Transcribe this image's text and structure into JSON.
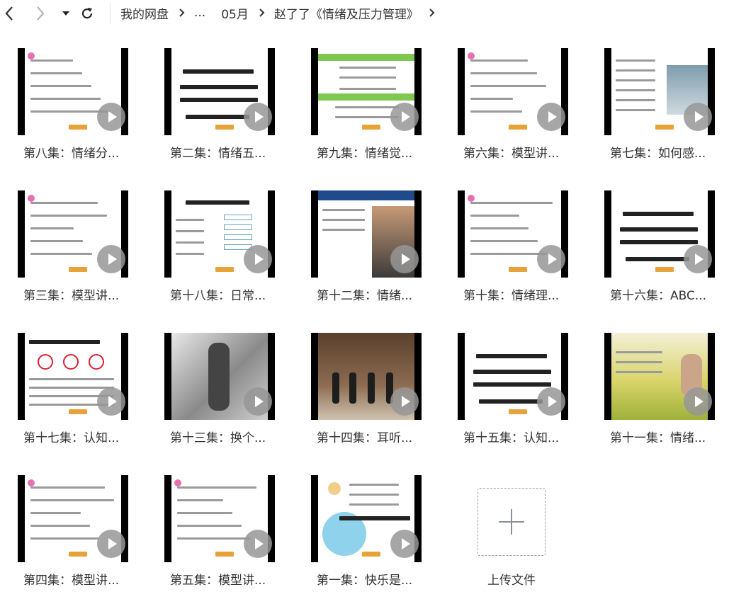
{
  "toolbar": {
    "back_icon": "chevron-left-icon",
    "forward_icon": "chevron-right-icon",
    "dropdown_icon": "caret-down-icon",
    "refresh_icon": "refresh-icon"
  },
  "breadcrumb": [
    "我的网盘",
    "...",
    "05月",
    "赵了了《情绪及压力管理》"
  ],
  "files": [
    {
      "name": "第八集：情绪分...",
      "thumb": "text"
    },
    {
      "name": "第二集：情绪五...",
      "thumb": "title"
    },
    {
      "name": "第九集：情绪觉...",
      "thumb": "bands"
    },
    {
      "name": "第六集：模型讲...",
      "thumb": "text"
    },
    {
      "name": "第七集：如何感...",
      "thumb": "photo-side"
    },
    {
      "name": "第三集：模型讲...",
      "thumb": "text"
    },
    {
      "name": "第十八集：日常...",
      "thumb": "diagram"
    },
    {
      "name": "第十二集：情绪...",
      "thumb": "person"
    },
    {
      "name": "第十集：情绪理...",
      "thumb": "text"
    },
    {
      "name": "第十六集：ABC...",
      "thumb": "title"
    },
    {
      "name": "第十七集：认知...",
      "thumb": "circles"
    },
    {
      "name": "第十三集：换个...",
      "thumb": "sketch"
    },
    {
      "name": "第十四集：耳听...",
      "thumb": "scene"
    },
    {
      "name": "第十五集：认知...",
      "thumb": "title"
    },
    {
      "name": "第十一集：情绪...",
      "thumb": "field"
    },
    {
      "name": "第四集：模型讲...",
      "thumb": "text"
    },
    {
      "name": "第五集：模型讲...",
      "thumb": "text"
    },
    {
      "name": "第一集：快乐是...",
      "thumb": "bubbles"
    }
  ],
  "upload": {
    "label": "上传文件",
    "icon": "plus-icon"
  },
  "colors": {
    "accent_green": "#7ec850",
    "tag_orange": "#e8a23a",
    "play_grey": "#969696"
  }
}
